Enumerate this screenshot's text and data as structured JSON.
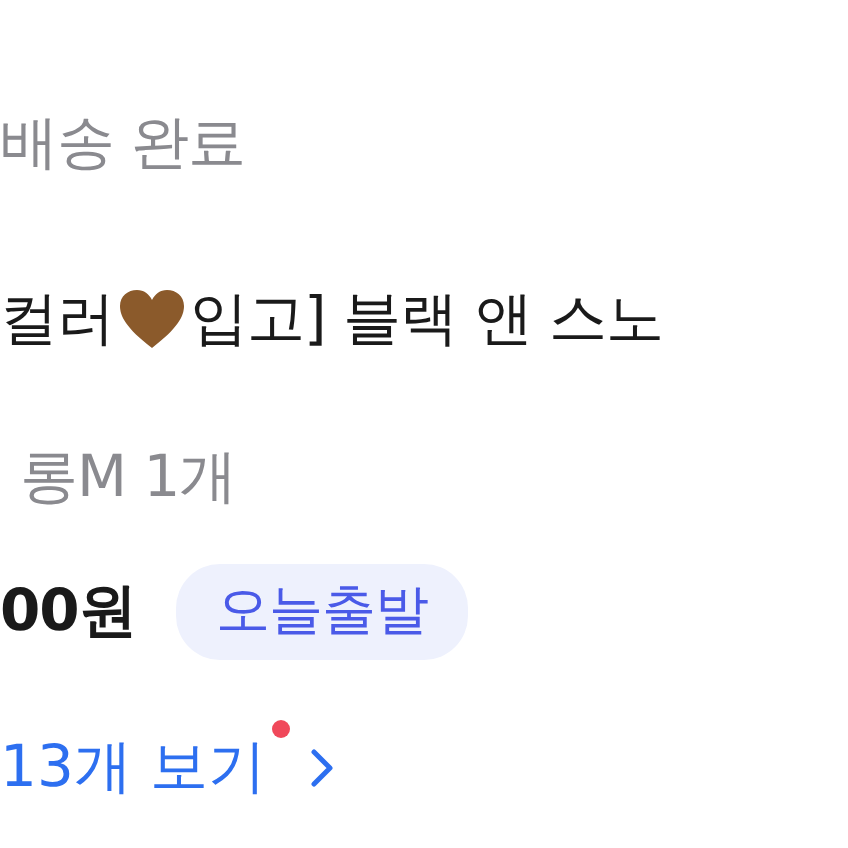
{
  "status": "배송 완료",
  "product": {
    "name_before": "컬러",
    "name_after": "입고] 블랙 앤 스노"
  },
  "option": "롱M 1개",
  "price": "00원",
  "badge": "오늘출발",
  "more": {
    "label": "13개 보기",
    "has_new": true
  }
}
